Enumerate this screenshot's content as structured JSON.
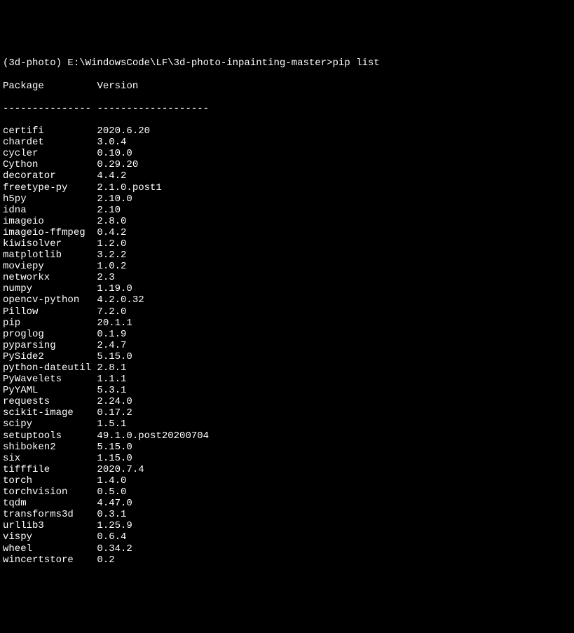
{
  "prompt": {
    "env": "(3d-photo)",
    "path": "E:\\WindowsCode\\LF\\3d-photo-inpainting-master>",
    "command": "pip list"
  },
  "header": {
    "col1": "Package",
    "col2": "Version"
  },
  "divider": {
    "col1": "---------------",
    "col2": "-------------------"
  },
  "packages": [
    {
      "name": "certifi",
      "version": "2020.6.20"
    },
    {
      "name": "chardet",
      "version": "3.0.4"
    },
    {
      "name": "cycler",
      "version": "0.10.0"
    },
    {
      "name": "Cython",
      "version": "0.29.20"
    },
    {
      "name": "decorator",
      "version": "4.4.2"
    },
    {
      "name": "freetype-py",
      "version": "2.1.0.post1"
    },
    {
      "name": "h5py",
      "version": "2.10.0"
    },
    {
      "name": "idna",
      "version": "2.10"
    },
    {
      "name": "imageio",
      "version": "2.8.0"
    },
    {
      "name": "imageio-ffmpeg",
      "version": "0.4.2"
    },
    {
      "name": "kiwisolver",
      "version": "1.2.0"
    },
    {
      "name": "matplotlib",
      "version": "3.2.2"
    },
    {
      "name": "moviepy",
      "version": "1.0.2"
    },
    {
      "name": "networkx",
      "version": "2.3"
    },
    {
      "name": "numpy",
      "version": "1.19.0"
    },
    {
      "name": "opencv-python",
      "version": "4.2.0.32"
    },
    {
      "name": "Pillow",
      "version": "7.2.0"
    },
    {
      "name": "pip",
      "version": "20.1.1"
    },
    {
      "name": "proglog",
      "version": "0.1.9"
    },
    {
      "name": "pyparsing",
      "version": "2.4.7"
    },
    {
      "name": "PySide2",
      "version": "5.15.0"
    },
    {
      "name": "python-dateutil",
      "version": "2.8.1"
    },
    {
      "name": "PyWavelets",
      "version": "1.1.1"
    },
    {
      "name": "PyYAML",
      "version": "5.3.1"
    },
    {
      "name": "requests",
      "version": "2.24.0"
    },
    {
      "name": "scikit-image",
      "version": "0.17.2"
    },
    {
      "name": "scipy",
      "version": "1.5.1"
    },
    {
      "name": "setuptools",
      "version": "49.1.0.post20200704"
    },
    {
      "name": "shiboken2",
      "version": "5.15.0"
    },
    {
      "name": "six",
      "version": "1.15.0"
    },
    {
      "name": "tifffile",
      "version": "2020.7.4"
    },
    {
      "name": "torch",
      "version": "1.4.0"
    },
    {
      "name": "torchvision",
      "version": "0.5.0"
    },
    {
      "name": "tqdm",
      "version": "4.47.0"
    },
    {
      "name": "transforms3d",
      "version": "0.3.1"
    },
    {
      "name": "urllib3",
      "version": "1.25.9"
    },
    {
      "name": "vispy",
      "version": "0.6.4"
    },
    {
      "name": "wheel",
      "version": "0.34.2"
    },
    {
      "name": "wincertstore",
      "version": "0.2"
    }
  ]
}
